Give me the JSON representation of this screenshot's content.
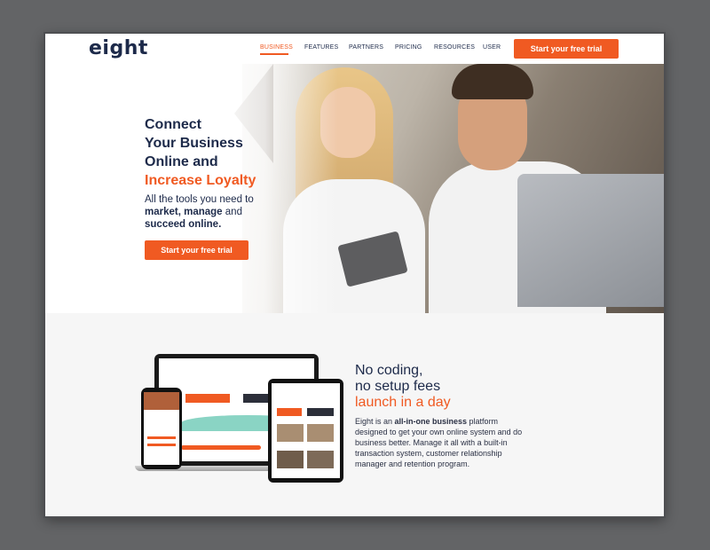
{
  "brand": {
    "logo_text": "eight",
    "accent_color": "#f05a22",
    "navy_color": "#1d2a4a"
  },
  "nav": {
    "items": [
      "BUSINESS",
      "FEATURES",
      "PARTNERS",
      "PRICING",
      "RESOURCES",
      "USER"
    ],
    "active": "BUSINESS",
    "cta_label": "Start your free trial"
  },
  "hero": {
    "title_line1": "Connect",
    "title_line2": "Your Business",
    "title_line3": "Online and",
    "title_accent": "Increase Loyalty",
    "sub_line1": "All the tools you need to",
    "sub_bold1": "market, manage",
    "sub_mid": " and",
    "sub_bold2": "succeed online.",
    "cta_label": "Start your free trial"
  },
  "features": {
    "title_line1": "No coding,",
    "title_line2": "no setup fees",
    "title_accent": "launch in a day",
    "desc_prefix": "Eight is an ",
    "desc_bold": "all-in-one business",
    "desc_rest": " platform designed to get your own online system and do business better. Manage it all with a built-in transaction system, customer relationship manager and retention program."
  }
}
